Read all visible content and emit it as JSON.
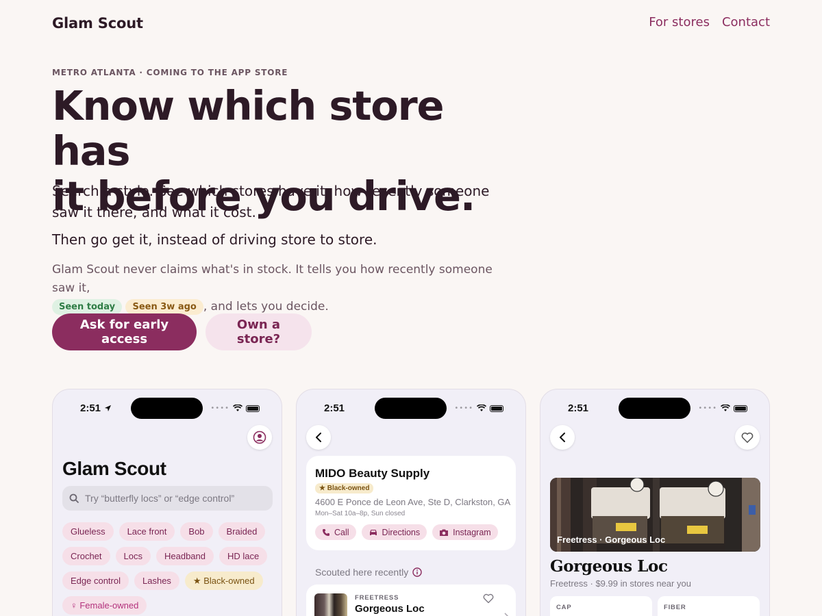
{
  "nav": {
    "brand": "Glam Scout",
    "links": [
      "For stores",
      "Contact"
    ]
  },
  "hero": {
    "eyebrow": "METRO ATLANTA · COMING TO THE APP STORE",
    "title_line1": "Know which store has",
    "title_line2": "it before you drive.",
    "subtitle": "Search a style. See which stores have it, how recently someone saw it there, and what it cost.",
    "subtitle2": "Then go get it, instead of driving store to store.",
    "note_before": "Glam Scout never claims what's in stock. It tells you how recently someone saw it,",
    "pill_today": "Seen today",
    "pill_ago": "Seen 3w ago",
    "note_after": ", and lets you decide."
  },
  "cta": {
    "primary": "Ask for early access",
    "secondary": "Own a store?"
  },
  "colors": {
    "accent": "#8b2d5f",
    "accent_soft": "#f5e3ec",
    "background": "#faf6f4",
    "green_pill": "#dff1e3",
    "amber_pill": "#fbecd0"
  },
  "phone1": {
    "time": "2:51",
    "profile_icon": "profile-icon",
    "title": "Glam Scout",
    "search_placeholder": "Try “butterfly locs” or “edge control”",
    "chips": [
      "Glueless",
      "Lace front",
      "Bob",
      "Braided",
      "Crochet",
      "Locs",
      "Headband",
      "HD lace",
      "Edge control",
      "Lashes"
    ],
    "chip_black_owned": "★ Black-owned",
    "chip_female_owned": "♀ Female-owned"
  },
  "phone2": {
    "time": "2:51",
    "store_name": "MIDO Beauty Supply",
    "badge": "★ Black-owned",
    "address": "4600 E Ponce de Leon Ave, Ste D, Clarkston, GA",
    "hours": "Mon–Sat 10a–8p, Sun closed",
    "actions": [
      "Call",
      "Directions",
      "Instagram"
    ],
    "section_label": "Scouted here recently",
    "row_brand": "FREETRESS",
    "row_name": "Gorgeous Loc"
  },
  "phone3": {
    "time": "2:51",
    "image_caption": "Freetress · Gorgeous Loc",
    "product_title": "Gorgeous Loc",
    "product_sub": "Freetress · $9.99 in stores near you",
    "spec1_label": "CAP",
    "spec2_label": "FIBER"
  }
}
